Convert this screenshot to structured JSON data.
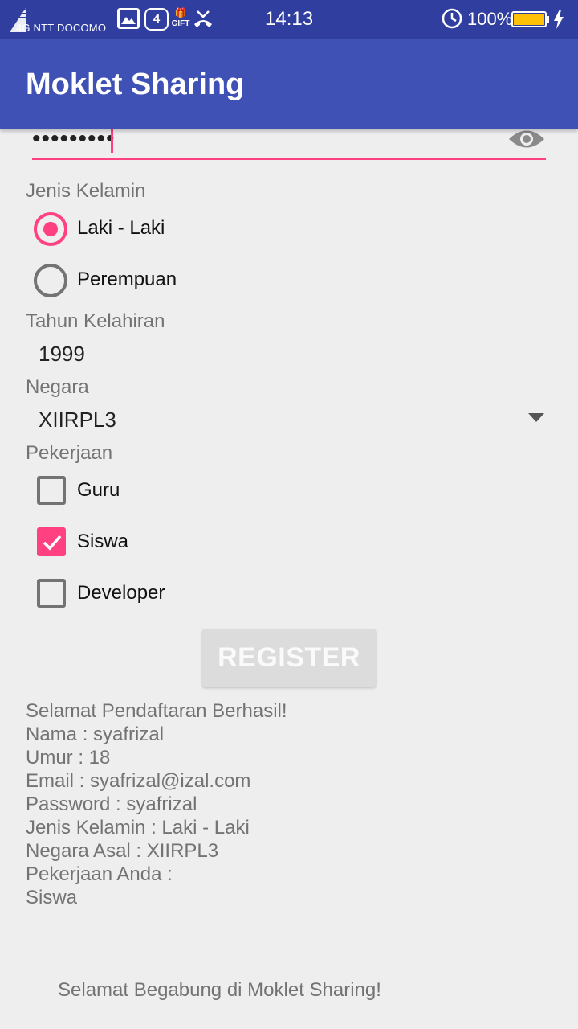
{
  "status_bar": {
    "network": "4G NTT DOCOMO",
    "notification_count": "4",
    "gift_label": "GIFT",
    "time": "14:13",
    "battery_percent": "100%",
    "battery_level": 1.0,
    "battery_color": "#ffc107"
  },
  "app_bar": {
    "title": "Moklet Sharing",
    "color": "#3f51b5"
  },
  "password": {
    "masked_value": "•••••••••",
    "toggle_icon": "eye-icon"
  },
  "gender": {
    "label": "Jenis Kelamin",
    "options": [
      {
        "label": "Laki - Laki",
        "checked": true
      },
      {
        "label": "Perempuan",
        "checked": false
      }
    ]
  },
  "birth_year": {
    "label": "Tahun Kelahiran",
    "value": "1999"
  },
  "country": {
    "label": "Negara",
    "selected": "XIIRPL3"
  },
  "job": {
    "label": "Pekerjaan",
    "options": [
      {
        "label": "Guru",
        "checked": false
      },
      {
        "label": "Siswa",
        "checked": true
      },
      {
        "label": "Developer",
        "checked": false
      }
    ]
  },
  "register_button": {
    "label": "REGISTER"
  },
  "result": {
    "lines": [
      "Selamat Pendaftaran Berhasil!",
      "Nama : syafrizal",
      "Umur : 18",
      "Email : syafrizal@izal.com",
      "Password : syafrizal",
      "Jenis Kelamin : Laki - Laki",
      "Negara Asal : XIIRPL3",
      "Pekerjaan Anda :",
      "Siswa"
    ]
  },
  "welcome": "Selamat Begabung di Moklet Sharing!",
  "accent_color": "#ff4081"
}
